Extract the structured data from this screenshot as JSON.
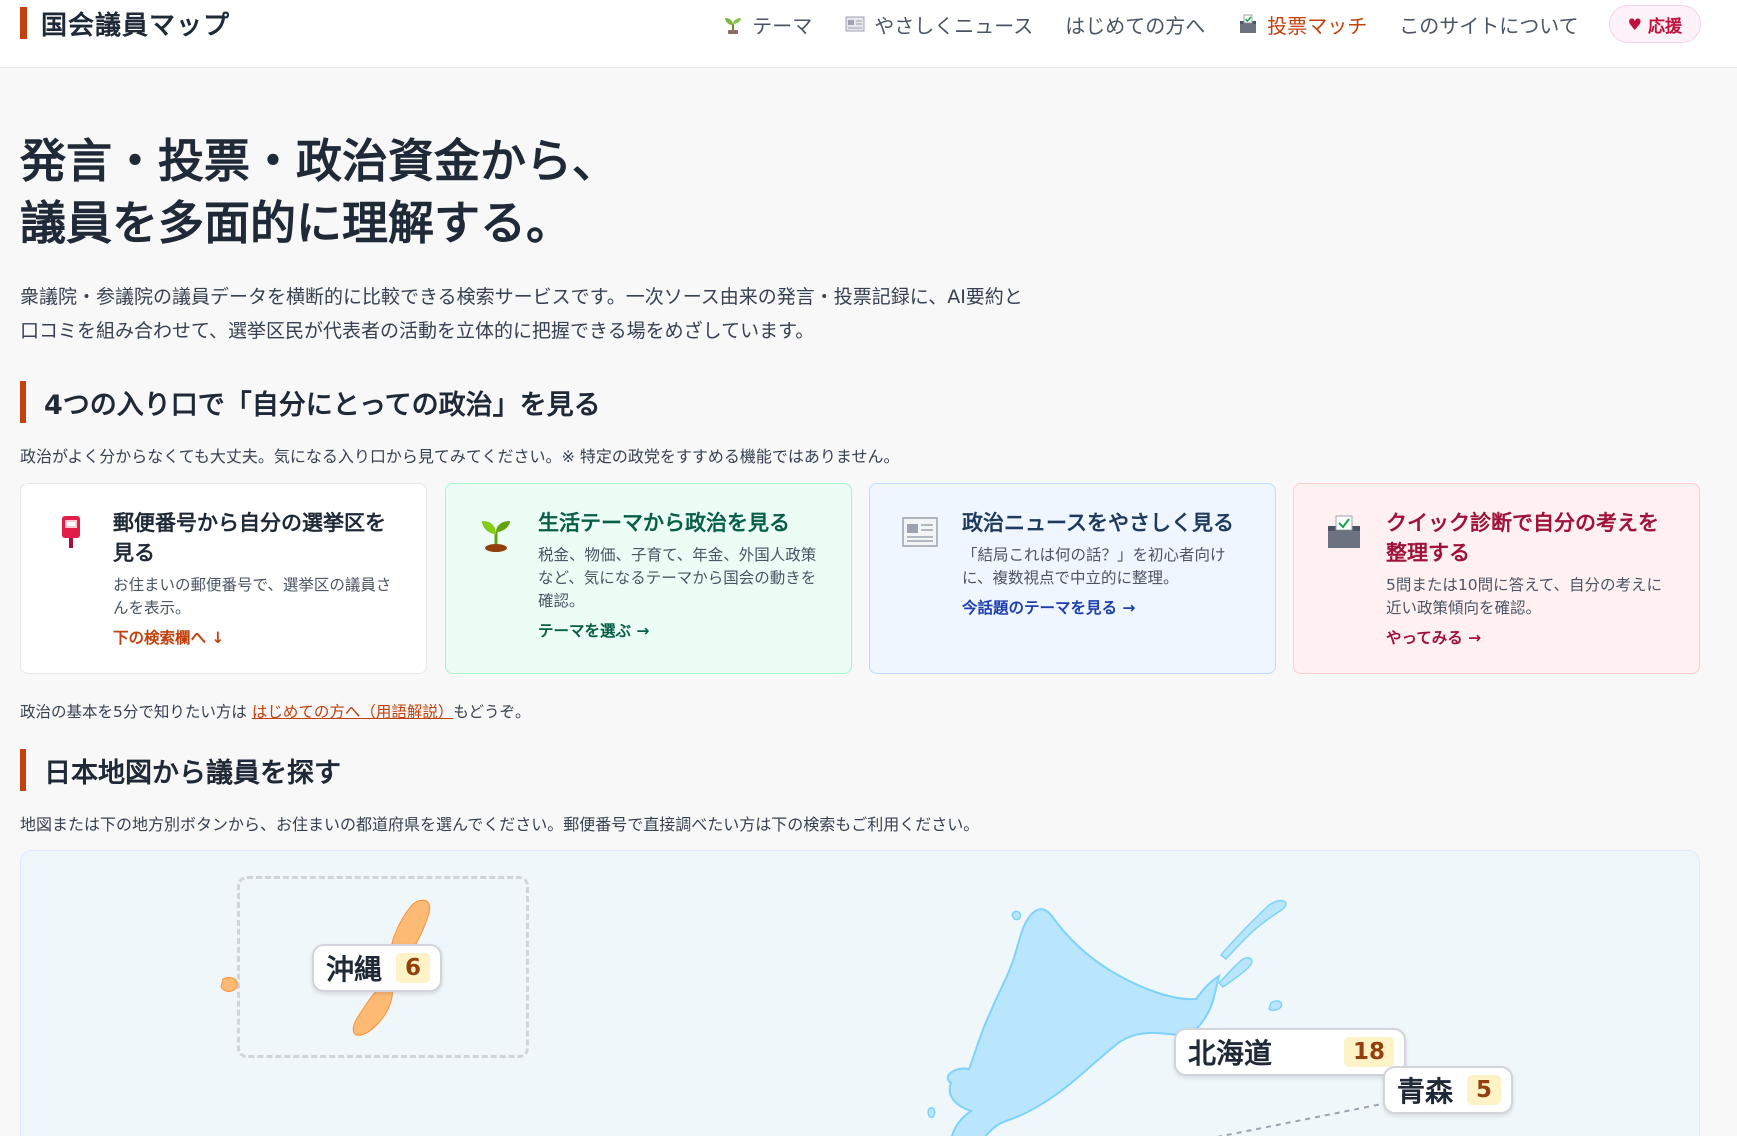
{
  "header": {
    "brand": "国会議員マップ",
    "nav": [
      {
        "label": "テーマ",
        "icon": "seedling-icon",
        "active": false
      },
      {
        "label": "やさしくニュース",
        "icon": "newspaper-icon",
        "active": false
      },
      {
        "label": "はじめての方へ",
        "icon": "",
        "active": false
      },
      {
        "label": "投票マッチ",
        "icon": "ballot-box-icon",
        "active": true
      },
      {
        "label": "このサイトについて",
        "icon": "",
        "active": false
      }
    ],
    "support_label": "応援"
  },
  "hero": {
    "title_line1": "発言・投票・政治資金から、",
    "title_line2": "議員を多面的に理解する。",
    "description": "衆議院・参議院の議員データを横断的に比較できる検索サービスです。一次ソース由来の発言・投票記録に、AI要約と口コミを組み合わせて、選挙区民が代表者の活動を立体的に把握できる場をめざしています。"
  },
  "entry_section": {
    "title": "4つの入り口で「自分にとっての政治」を見る",
    "subtitle": "政治がよく分からなくても大丈夫。気になる入り口から見てみてください。※ 特定の政党をすすめる機能ではありません。",
    "cards": [
      {
        "icon": "mailbox-icon",
        "title": "郵便番号から自分の選挙区を見る",
        "desc": "お住まいの郵便番号で、選挙区の議員さんを表示。",
        "link": "下の検索欄へ ↓"
      },
      {
        "icon": "seedling-icon",
        "title": "生活テーマから政治を見る",
        "desc": "税金、物価、子育て、年金、外国人政策など、気になるテーマから国会の動きを確認。",
        "link": "テーマを選ぶ →"
      },
      {
        "icon": "newspaper-icon",
        "title": "政治ニュースをやさしく見る",
        "desc": "「結局これは何の話？」を初心者向けに、複数視点で中立的に整理。",
        "link": "今話題のテーマを見る →"
      },
      {
        "icon": "ballot-box-icon",
        "title": "クイック診断で自分の考えを整理する",
        "desc": "5問または10問に答えて、自分の考えに近い政策傾向を確認。",
        "link": "やってみる →"
      }
    ],
    "beginner_prefix": "政治の基本を5分で知りたい方は",
    "beginner_link": "はじめての方へ（用語解説）",
    "beginner_suffix": "もどうぞ。"
  },
  "map_section": {
    "title": "日本地図から議員を探す",
    "subtitle": "地図または下の地方別ボタンから、お住まいの都道府県を選んでください。郵便番号で直接調べたい方は下の検索もご利用ください。",
    "prefectures": [
      {
        "name": "沖縄",
        "count": "6"
      },
      {
        "name": "北海道",
        "count": "18"
      },
      {
        "name": "青森",
        "count": "5"
      }
    ],
    "colors": {
      "okinawa": "#fdba74",
      "hokkaido": "#bae6fd",
      "hokkaido_stroke": "#7dd3fc"
    }
  }
}
